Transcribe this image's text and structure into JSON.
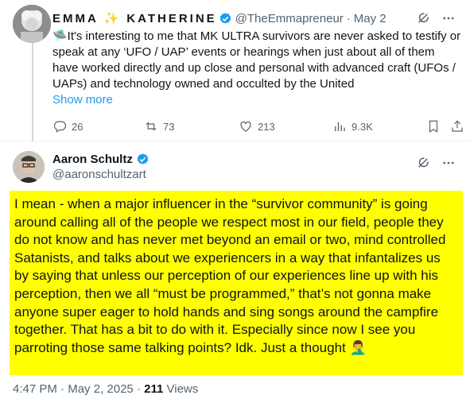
{
  "tweet1": {
    "author_name": "EMMA ✨ KATHERINE",
    "handle": "@TheEmmapreneur",
    "date": "May 2",
    "text": "🛸It's interesting to me that MK ULTRA survivors are never asked to testify or speak at any ‘UFO / UAP’ events or hearings when just about all of them have worked directly and up close and personal with advanced craft (UFOs / UAPs) and technology owned and occulted by the United",
    "show_more": "Show more",
    "replies": "26",
    "reposts": "73",
    "likes": "213",
    "views": "9.3K",
    "icons": [
      "grok-icon",
      "more-icon",
      "reply-icon",
      "repost-icon",
      "like-icon",
      "views-icon",
      "bookmark-icon",
      "share-icon"
    ]
  },
  "tweet2": {
    "author_name": "Aaron Schultz",
    "handle": "@aaronschultzart",
    "text": "I mean - when a major influencer in the “survivor community” is going around calling all of the people we respect most in our field, people they do not know and has never met beyond an email or two, mind controlled Satanists, and talks about we experiencers in a way that infantalizes us by saying that unless our perception of our experiences line up with his perception, then we all “must be programmed,” that’s not gonna make anyone super eager to hold hands and sing songs around the campfire together. That has a bit to do with it. Especially since now I see you parroting those same talking points? Idk. Just a thought 🤦‍♂️",
    "time": "4:47 PM",
    "date": "May 2, 2025",
    "views_count": "211",
    "views_label": "Views",
    "highlight_color": "#ffff00"
  },
  "colors": {
    "accent": "#1d9bf0",
    "muted": "#536471",
    "text": "#0f1419"
  }
}
